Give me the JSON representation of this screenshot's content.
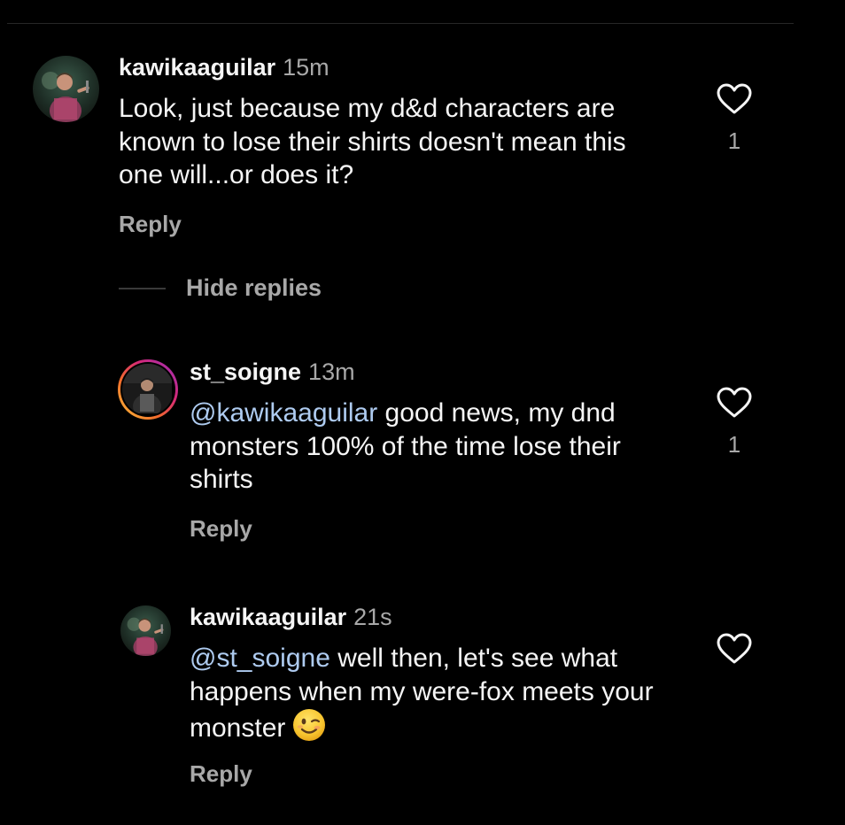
{
  "comments": [
    {
      "username": "kawikaaguilar",
      "time": "15m",
      "text": "Look, just because my d&d characters are known to lose their shirts doesn't mean this one will...or does it?",
      "reply_label": "Reply",
      "like_count": "1"
    }
  ],
  "hide_replies_label": "Hide replies",
  "replies": [
    {
      "username": "st_soigne",
      "time": "13m",
      "mention": "@kawikaaguilar",
      "text": " good news, my dnd monsters 100% of the time lose their shirts",
      "reply_label": "Reply",
      "like_count": "1"
    },
    {
      "username": "kawikaaguilar",
      "time": "21s",
      "mention": "@st_soigne",
      "text": " well then, let's see what happens when my were-fox meets your monster",
      "emoji": "winking-face-emoji",
      "reply_label": "Reply"
    }
  ],
  "icons": {
    "like": "heart-outline-icon"
  },
  "colors": {
    "background": "#000000",
    "text": "#f5f5f5",
    "secondary": "#a8a8a8",
    "mention": "#aecbf0"
  }
}
